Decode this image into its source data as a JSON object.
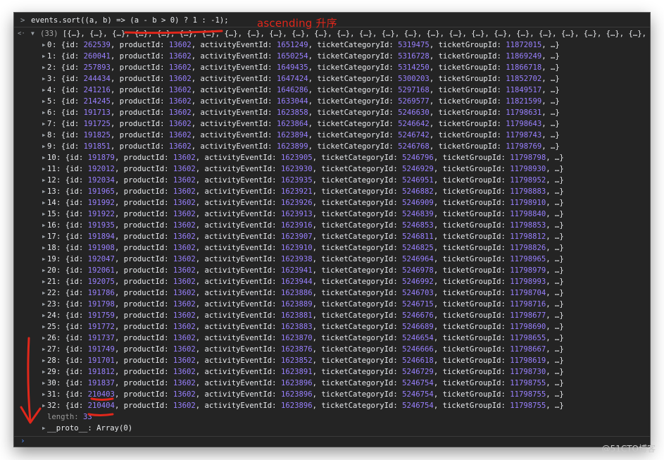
{
  "console": {
    "input_code": "events.sort((a, b) => (a - b > 0) ? 1 : -1);",
    "output_count": "(33)",
    "output_summary": "[{…}, {…}, {…}, {…}, {…}, {…}, {…}, {…}, {…}, {…}, {…}, {…}, {…}, {…}, {…}, {…}, {…}, {…}, {…}, {…}, {…}, {…}, {…}, {…}, {…}, {…}, {…}, {…}, {…}, {…}, {…}, {…}, {…}]",
    "rows": [
      {
        "idx": "0",
        "id": "262539",
        "productId": "13602",
        "activityEventId": "1651249",
        "ticketCategoryId": "5319475",
        "ticketGroupId": "11872015"
      },
      {
        "idx": "1",
        "id": "260041",
        "productId": "13602",
        "activityEventId": "1650254",
        "ticketCategoryId": "5316728",
        "ticketGroupId": "11869249"
      },
      {
        "idx": "2",
        "id": "257893",
        "productId": "13602",
        "activityEventId": "1649435",
        "ticketCategoryId": "5314250",
        "ticketGroupId": "11866718"
      },
      {
        "idx": "3",
        "id": "244434",
        "productId": "13602",
        "activityEventId": "1647424",
        "ticketCategoryId": "5300203",
        "ticketGroupId": "11852702"
      },
      {
        "idx": "4",
        "id": "241216",
        "productId": "13602",
        "activityEventId": "1646286",
        "ticketCategoryId": "5297168",
        "ticketGroupId": "11849517"
      },
      {
        "idx": "5",
        "id": "214245",
        "productId": "13602",
        "activityEventId": "1633044",
        "ticketCategoryId": "5269577",
        "ticketGroupId": "11821599"
      },
      {
        "idx": "6",
        "id": "191713",
        "productId": "13602",
        "activityEventId": "1623858",
        "ticketCategoryId": "5246630",
        "ticketGroupId": "11798631"
      },
      {
        "idx": "7",
        "id": "191725",
        "productId": "13602",
        "activityEventId": "1623864",
        "ticketCategoryId": "5246642",
        "ticketGroupId": "11798643"
      },
      {
        "idx": "8",
        "id": "191825",
        "productId": "13602",
        "activityEventId": "1623894",
        "ticketCategoryId": "5246742",
        "ticketGroupId": "11798743"
      },
      {
        "idx": "9",
        "id": "191851",
        "productId": "13602",
        "activityEventId": "1623899",
        "ticketCategoryId": "5246768",
        "ticketGroupId": "11798769"
      },
      {
        "idx": "10",
        "id": "191879",
        "productId": "13602",
        "activityEventId": "1623905",
        "ticketCategoryId": "5246796",
        "ticketGroupId": "11798798"
      },
      {
        "idx": "11",
        "id": "192012",
        "productId": "13602",
        "activityEventId": "1623930",
        "ticketCategoryId": "5246929",
        "ticketGroupId": "11798930"
      },
      {
        "idx": "12",
        "id": "192034",
        "productId": "13602",
        "activityEventId": "1623935",
        "ticketCategoryId": "5246951",
        "ticketGroupId": "11798952"
      },
      {
        "idx": "13",
        "id": "191965",
        "productId": "13602",
        "activityEventId": "1623921",
        "ticketCategoryId": "5246882",
        "ticketGroupId": "11798883"
      },
      {
        "idx": "14",
        "id": "191992",
        "productId": "13602",
        "activityEventId": "1623926",
        "ticketCategoryId": "5246909",
        "ticketGroupId": "11798910"
      },
      {
        "idx": "15",
        "id": "191922",
        "productId": "13602",
        "activityEventId": "1623913",
        "ticketCategoryId": "5246839",
        "ticketGroupId": "11798840"
      },
      {
        "idx": "16",
        "id": "191935",
        "productId": "13602",
        "activityEventId": "1623916",
        "ticketCategoryId": "5246853",
        "ticketGroupId": "11798853"
      },
      {
        "idx": "17",
        "id": "191894",
        "productId": "13602",
        "activityEventId": "1623907",
        "ticketCategoryId": "5246811",
        "ticketGroupId": "11798812"
      },
      {
        "idx": "18",
        "id": "191908",
        "productId": "13602",
        "activityEventId": "1623910",
        "ticketCategoryId": "5246825",
        "ticketGroupId": "11798826"
      },
      {
        "idx": "19",
        "id": "192047",
        "productId": "13602",
        "activityEventId": "1623938",
        "ticketCategoryId": "5246964",
        "ticketGroupId": "11798965"
      },
      {
        "idx": "20",
        "id": "192061",
        "productId": "13602",
        "activityEventId": "1623941",
        "ticketCategoryId": "5246978",
        "ticketGroupId": "11798979"
      },
      {
        "idx": "21",
        "id": "192075",
        "productId": "13602",
        "activityEventId": "1623944",
        "ticketCategoryId": "5246992",
        "ticketGroupId": "11798993"
      },
      {
        "idx": "22",
        "id": "191786",
        "productId": "13602",
        "activityEventId": "1623886",
        "ticketCategoryId": "5246703",
        "ticketGroupId": "11798704"
      },
      {
        "idx": "23",
        "id": "191798",
        "productId": "13602",
        "activityEventId": "1623889",
        "ticketCategoryId": "5246715",
        "ticketGroupId": "11798716"
      },
      {
        "idx": "24",
        "id": "191759",
        "productId": "13602",
        "activityEventId": "1623881",
        "ticketCategoryId": "5246676",
        "ticketGroupId": "11798677"
      },
      {
        "idx": "25",
        "id": "191772",
        "productId": "13602",
        "activityEventId": "1623883",
        "ticketCategoryId": "5246689",
        "ticketGroupId": "11798690"
      },
      {
        "idx": "26",
        "id": "191737",
        "productId": "13602",
        "activityEventId": "1623870",
        "ticketCategoryId": "5246654",
        "ticketGroupId": "11798655"
      },
      {
        "idx": "27",
        "id": "191749",
        "productId": "13602",
        "activityEventId": "1623876",
        "ticketCategoryId": "5246666",
        "ticketGroupId": "11798667"
      },
      {
        "idx": "28",
        "id": "191701",
        "productId": "13602",
        "activityEventId": "1623852",
        "ticketCategoryId": "5246618",
        "ticketGroupId": "11798619"
      },
      {
        "idx": "29",
        "id": "191812",
        "productId": "13602",
        "activityEventId": "1623891",
        "ticketCategoryId": "5246729",
        "ticketGroupId": "11798730"
      },
      {
        "idx": "30",
        "id": "191837",
        "productId": "13602",
        "activityEventId": "1623896",
        "ticketCategoryId": "5246754",
        "ticketGroupId": "11798755"
      },
      {
        "idx": "31",
        "id": "210403",
        "productId": "13602",
        "activityEventId": "1623896",
        "ticketCategoryId": "5246754",
        "ticketGroupId": "11798755"
      },
      {
        "idx": "32",
        "id": "210404",
        "productId": "13602",
        "activityEventId": "1623896",
        "ticketCategoryId": "5246754",
        "ticketGroupId": "11798755"
      }
    ],
    "length_label": "length:",
    "length_value": "33",
    "proto_label": "__proto__: Array(0)",
    "prompt_symbol": "›"
  },
  "annotation": {
    "text": "ascending 升序",
    "color": "#e0271b"
  },
  "watermark": "@51CTO博客",
  "colors": {
    "background": "#242424",
    "number": "#9980ff",
    "text": "#e8eaed",
    "prompt": "#4f8bf7"
  }
}
